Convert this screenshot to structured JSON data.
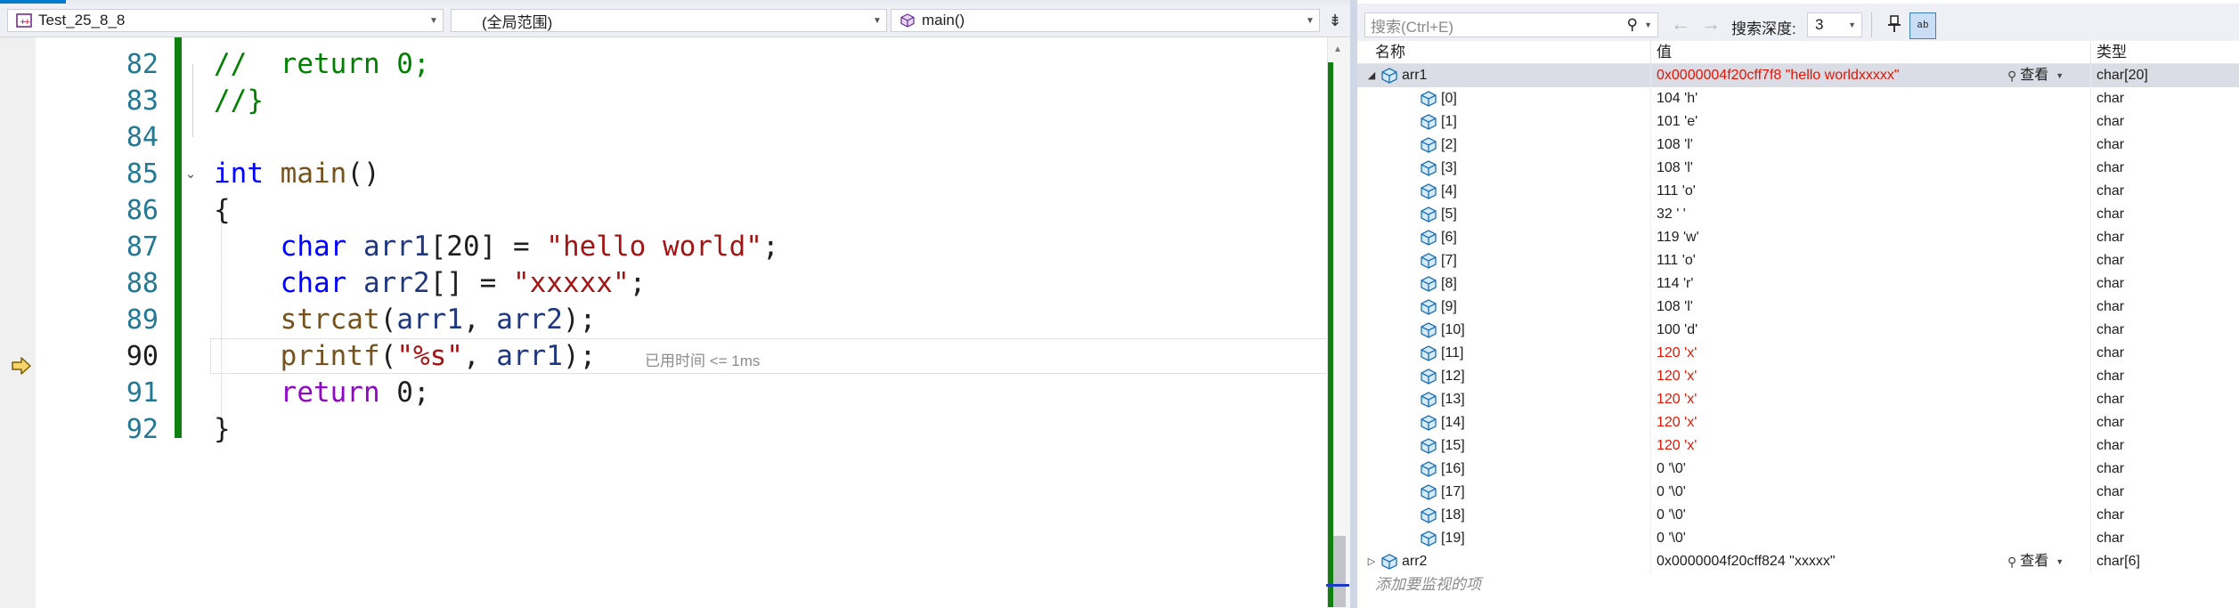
{
  "editor": {
    "project_combo": "Test_25_8_8",
    "scope_combo": "(全局范围)",
    "member_combo": "main()",
    "elapsed_hint": "已用时间 <= 1ms"
  },
  "code_lines": [
    {
      "num": "82",
      "parts": [
        {
          "t": "//  return 0;",
          "c": "cmt"
        }
      ]
    },
    {
      "num": "83",
      "parts": [
        {
          "t": "//}",
          "c": "cmt"
        }
      ]
    },
    {
      "num": "84",
      "parts": []
    },
    {
      "num": "85",
      "parts": [
        {
          "t": "int",
          "c": "kw"
        },
        {
          "t": " "
        },
        {
          "t": "main",
          "c": "fn"
        },
        {
          "t": "()"
        }
      ]
    },
    {
      "num": "86",
      "parts": [
        {
          "t": "{"
        }
      ]
    },
    {
      "num": "87",
      "parts": [
        {
          "t": "    "
        },
        {
          "t": "char",
          "c": "kw"
        },
        {
          "t": " "
        },
        {
          "t": "arr1",
          "c": "var"
        },
        {
          "t": "[20] = "
        },
        {
          "t": "\"hello world\"",
          "c": "str"
        },
        {
          "t": ";"
        }
      ]
    },
    {
      "num": "88",
      "parts": [
        {
          "t": "    "
        },
        {
          "t": "char",
          "c": "kw"
        },
        {
          "t": " "
        },
        {
          "t": "arr2",
          "c": "var"
        },
        {
          "t": "[] = "
        },
        {
          "t": "\"xxxxx\"",
          "c": "str"
        },
        {
          "t": ";"
        }
      ]
    },
    {
      "num": "89",
      "parts": [
        {
          "t": "    "
        },
        {
          "t": "strcat",
          "c": "fn"
        },
        {
          "t": "("
        },
        {
          "t": "arr1",
          "c": "var"
        },
        {
          "t": ", "
        },
        {
          "t": "arr2",
          "c": "var"
        },
        {
          "t": ");"
        }
      ]
    },
    {
      "num": "90",
      "parts": [
        {
          "t": "    "
        },
        {
          "t": "printf",
          "c": "fn"
        },
        {
          "t": "("
        },
        {
          "t": "\"%s\"",
          "c": "str"
        },
        {
          "t": ", "
        },
        {
          "t": "arr1",
          "c": "var"
        },
        {
          "t": ");"
        }
      ]
    },
    {
      "num": "91",
      "parts": [
        {
          "t": "    "
        },
        {
          "t": "return",
          "c": "kwp"
        },
        {
          "t": " 0;"
        }
      ]
    },
    {
      "num": "92",
      "parts": [
        {
          "t": "}"
        }
      ]
    }
  ],
  "watch": {
    "search_placeholder": "搜索(Ctrl+E)",
    "depth_label": "搜索深度:",
    "depth_value": "3",
    "hex_label": "ab",
    "columns": {
      "name": "名称",
      "value": "值",
      "type": "类型"
    },
    "viewer_label": "查看",
    "add_item": "添加要监视的项",
    "rows": [
      {
        "name": "arr1",
        "value": "0x0000004f20cff7f8 \"hello worldxxxxx\"",
        "type": "char[20]",
        "level": 0,
        "expand": "expanded",
        "changed": true,
        "selected": true,
        "viewer": true
      },
      {
        "name": "[0]",
        "value": "104 'h'",
        "type": "char",
        "level": 1,
        "changed": false
      },
      {
        "name": "[1]",
        "value": "101 'e'",
        "type": "char",
        "level": 1,
        "changed": false
      },
      {
        "name": "[2]",
        "value": "108 'l'",
        "type": "char",
        "level": 1,
        "changed": false
      },
      {
        "name": "[3]",
        "value": "108 'l'",
        "type": "char",
        "level": 1,
        "changed": false
      },
      {
        "name": "[4]",
        "value": "111 'o'",
        "type": "char",
        "level": 1,
        "changed": false
      },
      {
        "name": "[5]",
        "value": "32 ' '",
        "type": "char",
        "level": 1,
        "changed": false
      },
      {
        "name": "[6]",
        "value": "119 'w'",
        "type": "char",
        "level": 1,
        "changed": false
      },
      {
        "name": "[7]",
        "value": "111 'o'",
        "type": "char",
        "level": 1,
        "changed": false
      },
      {
        "name": "[8]",
        "value": "114 'r'",
        "type": "char",
        "level": 1,
        "changed": false
      },
      {
        "name": "[9]",
        "value": "108 'l'",
        "type": "char",
        "level": 1,
        "changed": false
      },
      {
        "name": "[10]",
        "value": "100 'd'",
        "type": "char",
        "level": 1,
        "changed": false
      },
      {
        "name": "[11]",
        "value": "120 'x'",
        "type": "char",
        "level": 1,
        "changed": true
      },
      {
        "name": "[12]",
        "value": "120 'x'",
        "type": "char",
        "level": 1,
        "changed": true
      },
      {
        "name": "[13]",
        "value": "120 'x'",
        "type": "char",
        "level": 1,
        "changed": true
      },
      {
        "name": "[14]",
        "value": "120 'x'",
        "type": "char",
        "level": 1,
        "changed": true
      },
      {
        "name": "[15]",
        "value": "120 'x'",
        "type": "char",
        "level": 1,
        "changed": true
      },
      {
        "name": "[16]",
        "value": "0 '\\0'",
        "type": "char",
        "level": 1,
        "changed": false
      },
      {
        "name": "[17]",
        "value": "0 '\\0'",
        "type": "char",
        "level": 1,
        "changed": false
      },
      {
        "name": "[18]",
        "value": "0 '\\0'",
        "type": "char",
        "level": 1,
        "changed": false
      },
      {
        "name": "[19]",
        "value": "0 '\\0'",
        "type": "char",
        "level": 1,
        "changed": false
      },
      {
        "name": "arr2",
        "value": "0x0000004f20cff824 \"xxxxx\"",
        "type": "char[6]",
        "level": 0,
        "expand": "collapsed",
        "changed": false,
        "viewer": true
      }
    ]
  },
  "colors": {
    "accent": "#007acc",
    "changed_value": "#e51400",
    "change_bar": "#108010",
    "keyword": "#0000ff",
    "string": "#a31515",
    "comment": "#008000",
    "function": "#74531f",
    "variable": "#1f377f"
  },
  "icons": {
    "project": "cpp-project-icon",
    "member": "method-cube-icon",
    "exec_pointer": "current-statement-arrow-icon",
    "watch_var": "variable-cube-icon",
    "search": "search-icon",
    "pin": "pin-icon"
  }
}
